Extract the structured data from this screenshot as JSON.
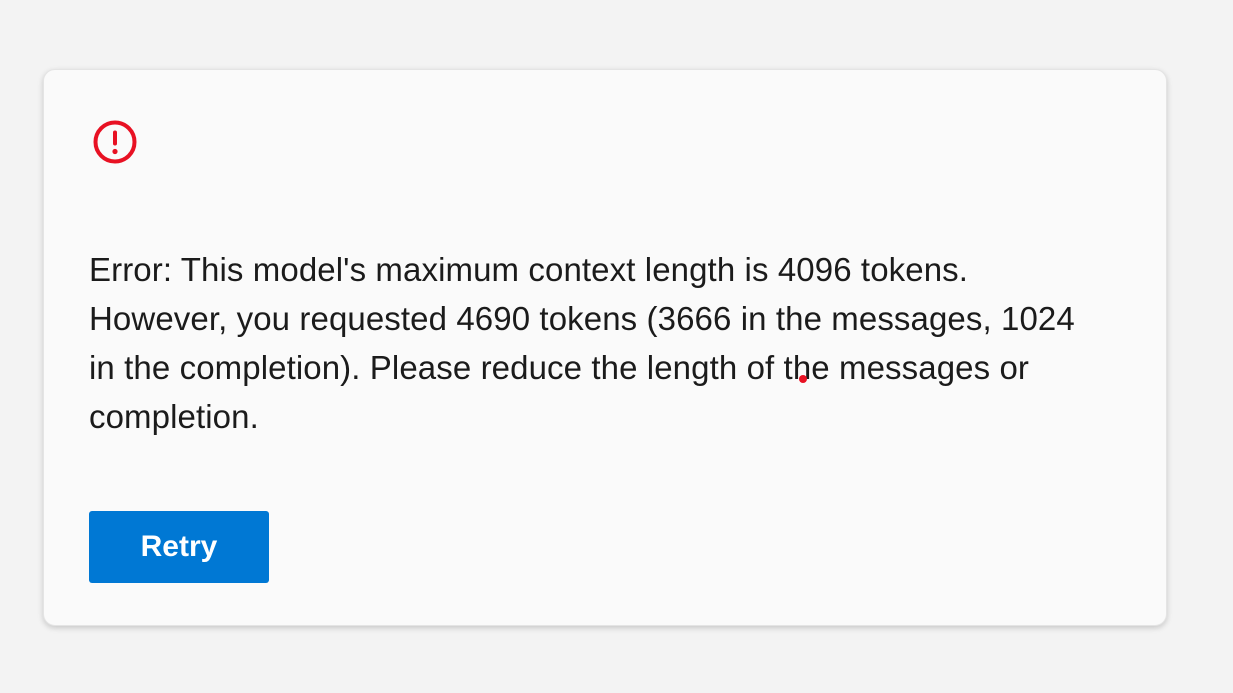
{
  "error_card": {
    "icon": "error-circle-exclamation-icon",
    "icon_color": "#e81123",
    "message": "Error: This model's maximum context length is 4096 tokens. However, you requested 4690 tokens (3666 in the messages, 1024 in the completion). Please reduce the length of the messages or completion.",
    "retry_label": "Retry",
    "retry_color": "#0078d4"
  }
}
